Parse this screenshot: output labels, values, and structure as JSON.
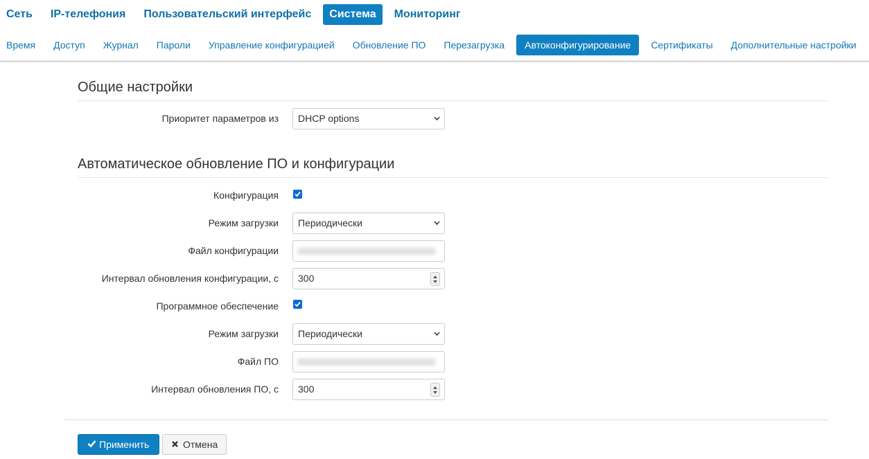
{
  "top_nav": [
    {
      "label": "Сеть",
      "active": false
    },
    {
      "label": "IP-телефония",
      "active": false
    },
    {
      "label": "Пользовательский интерфейс",
      "active": false
    },
    {
      "label": "Система",
      "active": true
    },
    {
      "label": "Мониторинг",
      "active": false
    }
  ],
  "sub_nav": [
    {
      "label": "Время",
      "active": false
    },
    {
      "label": "Доступ",
      "active": false
    },
    {
      "label": "Журнал",
      "active": false
    },
    {
      "label": "Пароли",
      "active": false
    },
    {
      "label": "Управление конфигурацией",
      "active": false
    },
    {
      "label": "Обновление ПО",
      "active": false
    },
    {
      "label": "Перезагрузка",
      "active": false
    },
    {
      "label": "Автоконфигурирование",
      "active": true
    },
    {
      "label": "Сертификаты",
      "active": false
    },
    {
      "label": "Дополнительные настройки",
      "active": false
    }
  ],
  "general": {
    "title": "Общие настройки",
    "priority_label": "Приоритет параметров из",
    "priority_value": "DHCP options"
  },
  "auto_update": {
    "title": "Автоматическое обновление ПО и конфигурации",
    "config_label": "Конфигурация",
    "config_checked": true,
    "config_mode_label": "Режим загрузки",
    "config_mode_value": "Периодически",
    "config_file_label": "Файл конфигурации",
    "config_interval_label": "Интервал обновления конфигурации, с",
    "config_interval_value": "300",
    "fw_label": "Программное обеспечение",
    "fw_checked": true,
    "fw_mode_label": "Режим загрузки",
    "fw_mode_value": "Периодически",
    "fw_file_label": "Файл ПО",
    "fw_interval_label": "Интервал обновления ПО, с",
    "fw_interval_value": "300"
  },
  "buttons": {
    "apply_label": "Применить",
    "cancel_label": "Отмена"
  },
  "colors": {
    "accent": "#0f80c1",
    "link": "#1477b4",
    "checkbox": "#0b6ad8"
  },
  "icons": {
    "select_arrow": "chevron-down-icon",
    "apply": "check-icon",
    "cancel": "close-icon"
  }
}
